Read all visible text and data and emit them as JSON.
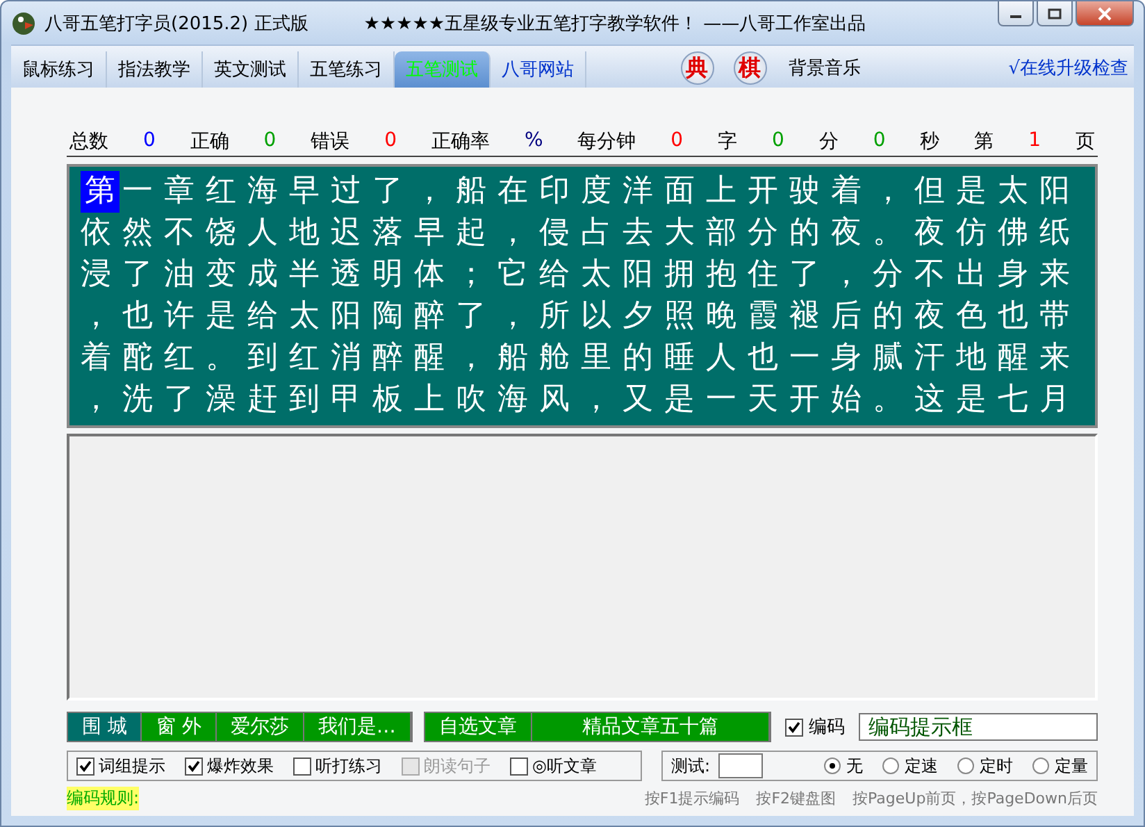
{
  "window": {
    "title": "八哥五笔打字员(2015.2) 正式版",
    "subtitle": "★★★★★五星级专业五笔打字教学软件！ ——八哥工作室出品"
  },
  "tabs": [
    {
      "label": "鼠标练习",
      "selected": false
    },
    {
      "label": "指法教学",
      "selected": false
    },
    {
      "label": "英文测试",
      "selected": false
    },
    {
      "label": "五笔练习",
      "selected": false
    },
    {
      "label": "五笔测试",
      "selected": true
    },
    {
      "label": "八哥网站",
      "selected": false,
      "kind": "link"
    }
  ],
  "toolbar": {
    "dict_button": "典",
    "chess_button": "棋",
    "music": "背景音乐",
    "upgrade": "√在线升级检查"
  },
  "stats": [
    {
      "kind": "label",
      "text": "总数"
    },
    {
      "kind": "value",
      "text": "0",
      "color": "#0000ff"
    },
    {
      "kind": "label",
      "text": "正确"
    },
    {
      "kind": "value",
      "text": "0",
      "color": "#00a000"
    },
    {
      "kind": "label",
      "text": "错误"
    },
    {
      "kind": "value",
      "text": "0",
      "color": "#ff0000"
    },
    {
      "kind": "label",
      "text": "正确率"
    },
    {
      "kind": "value",
      "text": "%",
      "color": "#000080"
    },
    {
      "kind": "label",
      "text": "每分钟"
    },
    {
      "kind": "value",
      "text": "0",
      "color": "#ff0000"
    },
    {
      "kind": "label",
      "text": "字"
    },
    {
      "kind": "value",
      "text": "0",
      "color": "#00a000"
    },
    {
      "kind": "label",
      "text": "分"
    },
    {
      "kind": "value",
      "text": "0",
      "color": "#00a000"
    },
    {
      "kind": "label",
      "text": "秒"
    },
    {
      "kind": "label",
      "text": "第"
    },
    {
      "kind": "value",
      "text": "1",
      "color": "#ff0000"
    },
    {
      "kind": "label",
      "text": "页"
    }
  ],
  "passage": {
    "current_char": "第",
    "lines": [
      "一章红海早过了，船在印度洋面上开驶着，但是太阳",
      "依然不饶人地迟落早起，侵占去大部分的夜。夜仿佛纸",
      "浸了油变成半透明体；它给太阳拥抱住了，分不出身来",
      "，也许是给太阳陶醉了，所以夕照晚霞褪后的夜色也带",
      "着酡红。到红消醉醒，船舱里的睡人也一身腻汗地醒来",
      "，洗了澡赶到甲板上吹海风，又是一天开始。这是七月"
    ]
  },
  "articles": [
    {
      "label": "围 城",
      "selected": true
    },
    {
      "label": "窗 外",
      "selected": false
    },
    {
      "label": "爱尔莎",
      "selected": false
    },
    {
      "label": "我们是…",
      "selected": false
    }
  ],
  "article_buttons": [
    "自选文章",
    "精品文章五十篇"
  ],
  "code_toggle": {
    "label": "编码",
    "checked": true
  },
  "code_hint_field": {
    "value": "编码提示框"
  },
  "options": [
    {
      "label": "词组提示",
      "checked": true,
      "disabled": false
    },
    {
      "label": "爆炸效果",
      "checked": true,
      "disabled": false
    },
    {
      "label": "听打练习",
      "checked": false,
      "disabled": false
    },
    {
      "label": "朗读句子",
      "checked": false,
      "disabled": true
    },
    {
      "label": "◎听文章",
      "checked": false,
      "disabled": false
    }
  ],
  "test": {
    "label": "测试:",
    "modes": [
      {
        "label": "无",
        "selected": true
      },
      {
        "label": "定速",
        "selected": false
      },
      {
        "label": "定时",
        "selected": false
      },
      {
        "label": "定量",
        "selected": false
      }
    ]
  },
  "code_rule": "编码规则:",
  "hints": [
    "按F1提示编码",
    "按F2键盘图",
    "按PageUp前页，按PageDown后页"
  ]
}
